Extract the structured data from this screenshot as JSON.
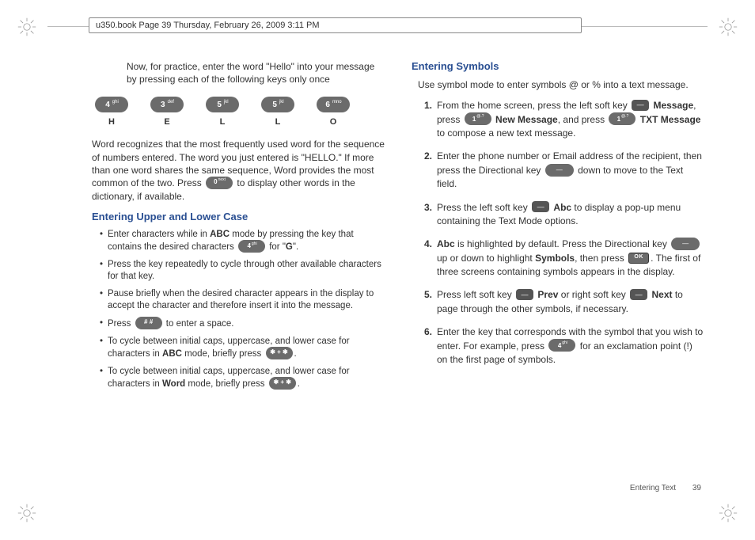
{
  "header": "u350.book  Page 39  Thursday, February 26, 2009  3:11 PM",
  "intro": "Now, for practice, enter the word \"Hello\" into your message by pressing each of the following keys only once",
  "keys": [
    {
      "digit": "4",
      "sup": "ghi",
      "letter": "H"
    },
    {
      "digit": "3",
      "sup": "def",
      "letter": "E"
    },
    {
      "digit": "5",
      "sup": "jkl",
      "letter": "L"
    },
    {
      "digit": "5",
      "sup": "jkl",
      "letter": "L"
    },
    {
      "digit": "6",
      "sup": "mno",
      "letter": "O"
    }
  ],
  "word_para_pre": "Word recognizes that the most frequently used word for the sequence of numbers entered. The word you just entered is \"HELLO.\" If more than one word shares the same sequence, Word provides the most common of the two. Press ",
  "word_para_post": " to display other words in the dictionary, if available.",
  "zero_key": {
    "digit": "0",
    "sup": "next"
  },
  "heading_case": "Entering Upper and Lower Case",
  "case_bullets": {
    "b1_pre": "Enter characters while in ",
    "b1_mode": "ABC",
    "b1_mid": " mode by pressing the key that contains the desired characters ",
    "b1_post": " for \"",
    "b1_G": "G",
    "b1_end": "\".",
    "b1_key": {
      "digit": "4",
      "sup": "ghi"
    },
    "b2": "Press the key repeatedly to cycle through other available characters for that key.",
    "b3": "Pause briefly when the desired character appears in the display to accept the character and therefore insert it into the message.",
    "b4_pre": "Press ",
    "b4_post": " to enter a space.",
    "b4_key": "# #",
    "b5_pre": "To cycle between initial caps, uppercase, and lower case for characters in ",
    "b5_mode": "ABC",
    "b5_mid": " mode, briefly press ",
    "b5_end": ".",
    "b6_pre": "To cycle between initial caps, uppercase, and lower case for characters in ",
    "b6_mode": "Word",
    "b6_mid": " mode, briefly press ",
    "b6_end": ".",
    "star_key": "✱ + ✱"
  },
  "heading_symbols": "Entering Symbols",
  "symbols_intro": "Use symbol mode to enter symbols @ or % into a text message.",
  "steps": {
    "s1_pre": "From the home screen, press the left soft key ",
    "s1_msg": "Message",
    "s1_mid1": ", press ",
    "s1_newmsg": "New Message",
    "s1_mid2": ", and press ",
    "s1_txt": "TXT Message",
    "s1_post": " to compose a new text message.",
    "s1_key": {
      "digit": "1",
      "sup": "@.?"
    },
    "s2_pre": "Enter the phone number or Email address of the recipient, then press the Directional key ",
    "s2_post": " down to move to the Text field.",
    "s3_pre": "Press the left soft key ",
    "s3_abc": "Abc",
    "s3_post": " to display a pop-up menu containing the Text Mode options.",
    "s4_abc": "Abc",
    "s4_pre2": " is highlighted by default. Press the Directional key ",
    "s4_mid": " up or down to highlight ",
    "s4_sym": "Symbols",
    "s4_mid2": ", then press ",
    "s4_post": ". The first of three screens containing symbols appears in the display.",
    "s5_pre": "Press left soft key ",
    "s5_prev": "Prev",
    "s5_mid": " or right soft key ",
    "s5_next": "Next",
    "s5_post": " to page through the other symbols, if necessary.",
    "s6_pre": "Enter the key that corresponds with the symbol that you wish to enter. For example, press ",
    "s6_post": " for an exclamation point (!) on the first page of symbols.",
    "s6_key": {
      "digit": "4",
      "sup": "ghi"
    }
  },
  "footer_section": "Entering Text",
  "footer_page": "39",
  "ok_label": "OK",
  "dash_label": "—",
  "nums": {
    "n1": "1.",
    "n2": "2.",
    "n3": "3.",
    "n4": "4.",
    "n5": "5.",
    "n6": "6."
  }
}
